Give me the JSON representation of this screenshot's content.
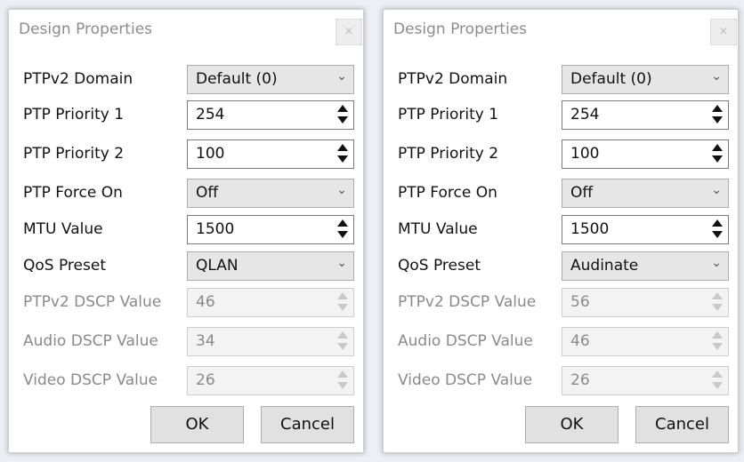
{
  "dialogs": [
    {
      "title": "Design Properties",
      "close_glyph": "×",
      "fields": {
        "ptpv2_domain": {
          "label": "PTPv2 Domain",
          "value": "Default (0)"
        },
        "ptp_priority_1": {
          "label": "PTP Priority 1",
          "value": "254"
        },
        "ptp_priority_2": {
          "label": "PTP Priority 2",
          "value": "100"
        },
        "ptp_force_on": {
          "label": "PTP Force On",
          "value": "Off"
        },
        "mtu_value": {
          "label": "MTU Value",
          "value": "1500"
        },
        "qos_preset": {
          "label": "QoS Preset",
          "value": "QLAN"
        },
        "ptpv2_dscp": {
          "label": "PTPv2 DSCP Value",
          "value": "46"
        },
        "audio_dscp": {
          "label": "Audio DSCP Value",
          "value": "34"
        },
        "video_dscp": {
          "label": "Video DSCP Value",
          "value": "26"
        }
      },
      "ok_label": "OK",
      "cancel_label": "Cancel"
    },
    {
      "title": "Design Properties",
      "close_glyph": "×",
      "fields": {
        "ptpv2_domain": {
          "label": "PTPv2 Domain",
          "value": "Default (0)"
        },
        "ptp_priority_1": {
          "label": "PTP Priority 1",
          "value": "254"
        },
        "ptp_priority_2": {
          "label": "PTP Priority 2",
          "value": "100"
        },
        "ptp_force_on": {
          "label": "PTP Force On",
          "value": "Off"
        },
        "mtu_value": {
          "label": "MTU Value",
          "value": "1500"
        },
        "qos_preset": {
          "label": "QoS Preset",
          "value": "Audinate"
        },
        "ptpv2_dscp": {
          "label": "PTPv2 DSCP Value",
          "value": "56"
        },
        "audio_dscp": {
          "label": "Audio DSCP Value",
          "value": "46"
        },
        "video_dscp": {
          "label": "Video DSCP Value",
          "value": "26"
        }
      },
      "ok_label": "OK",
      "cancel_label": "Cancel"
    }
  ],
  "icons": {
    "dropdown": "chevron-down-icon",
    "spinner": "spinner-arrows-icon",
    "close": "close-icon"
  },
  "colors": {
    "label_enabled": "#111111",
    "label_disabled": "#8a8a8a",
    "title": "#8c8c8c",
    "button_bg": "#e1e1e1",
    "select_bg": "#e6e6e6"
  }
}
